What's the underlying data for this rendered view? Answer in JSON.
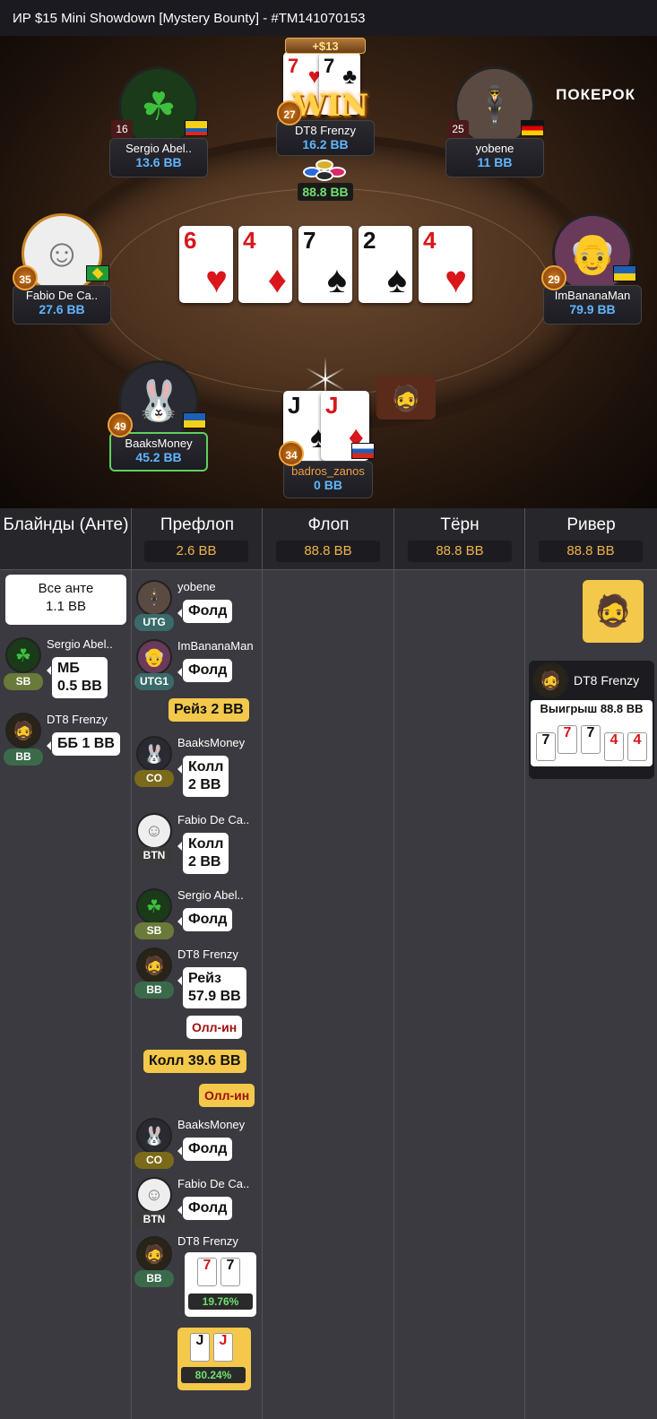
{
  "title": "ИР  $15 Mini Showdown [Mystery Bounty]   - #TM141070153",
  "brand": "ПОКЕРОК",
  "table": {
    "win_amount": "+$13",
    "win_text": "WIN",
    "pot": "88.8 BB",
    "board": [
      {
        "rank": "6",
        "suit": "♥",
        "color": "red"
      },
      {
        "rank": "4",
        "suit": "♦",
        "color": "red"
      },
      {
        "rank": "7",
        "suit": "♠",
        "color": "blk"
      },
      {
        "rank": "2",
        "suit": "♠",
        "color": "blk"
      },
      {
        "rank": "4",
        "suit": "♥",
        "color": "red"
      }
    ],
    "seats": {
      "sergio": {
        "name": "Sergio Abel..",
        "stack": "13.6 BB",
        "level": "16"
      },
      "dt8": {
        "name": "DT8 Frenzy",
        "stack": "16.2 BB",
        "level": "27"
      },
      "yobene": {
        "name": "yobene",
        "stack": "11 BB",
        "level": "25"
      },
      "fabio": {
        "name": "Fabio De Ca..",
        "stack": "27.6 BB",
        "level": "35"
      },
      "imbanana": {
        "name": "ImBananaMan",
        "stack": "79.9 BB",
        "level": "29"
      },
      "baaks": {
        "name": "BaaksMoney",
        "stack": "45.2 BB",
        "level": "49"
      },
      "badros": {
        "name": "badros_zanos",
        "stack": "0 BB",
        "level": "34"
      }
    }
  },
  "history": {
    "columns": [
      {
        "label": "Блайнды (Анте)",
        "pot": ""
      },
      {
        "label": "Префлоп",
        "pot": "2.6 BB"
      },
      {
        "label": "Флоп",
        "pot": "88.8 BB"
      },
      {
        "label": "Тёрн",
        "pot": "88.8 BB"
      },
      {
        "label": "Ривер",
        "pot": "88.8 BB"
      }
    ],
    "blinds": {
      "ante_line1": "Все анте",
      "ante_line2": "1.1 BB",
      "sb_name": "Sergio Abel..",
      "sb_pos": "SB",
      "sb_act1": "МБ",
      "sb_act2": "0.5 BB",
      "bb_name": "DT8 Frenzy",
      "bb_pos": "BB",
      "bb_act": "ББ 1 BB"
    },
    "preflop": [
      {
        "name": "yobene",
        "pos": "UTG",
        "action": "Фолд"
      },
      {
        "name": "ImBananaMan",
        "pos": "UTG1",
        "action": "Фолд"
      },
      {
        "hero_raise": "Рейз 2 BB"
      },
      {
        "name": "BaaksMoney",
        "pos": "CO",
        "action1": "Колл",
        "action2": "2 BB"
      },
      {
        "name": "Fabio De Ca..",
        "pos": "BTN",
        "action1": "Колл",
        "action2": "2 BB"
      },
      {
        "name": "Sergio Abel..",
        "pos": "SB",
        "action": "Фолд"
      },
      {
        "name": "DT8 Frenzy",
        "pos": "BB",
        "action1": "Рейз",
        "action2": "57.9 BB",
        "allin": "Олл-ин"
      },
      {
        "hero_call": "Колл 39.6 BB",
        "hero_allin": "Олл-ин"
      },
      {
        "name": "BaaksMoney",
        "pos": "CO",
        "action": "Фолд"
      },
      {
        "name": "Fabio De Ca..",
        "pos": "BTN",
        "action": "Фолд"
      },
      {
        "name": "DT8 Frenzy",
        "pos": "BB",
        "cards": [
          "7",
          "7"
        ],
        "equity": "19.76%"
      },
      {
        "hero_cards": [
          "J",
          "J"
        ],
        "hero_equity": "80.24%"
      }
    ],
    "river": {
      "winner": "DT8 Frenzy",
      "win_label": "Выигрыш 88.8 BB",
      "cards": [
        "7",
        "7",
        "7",
        "4",
        "4"
      ]
    }
  }
}
